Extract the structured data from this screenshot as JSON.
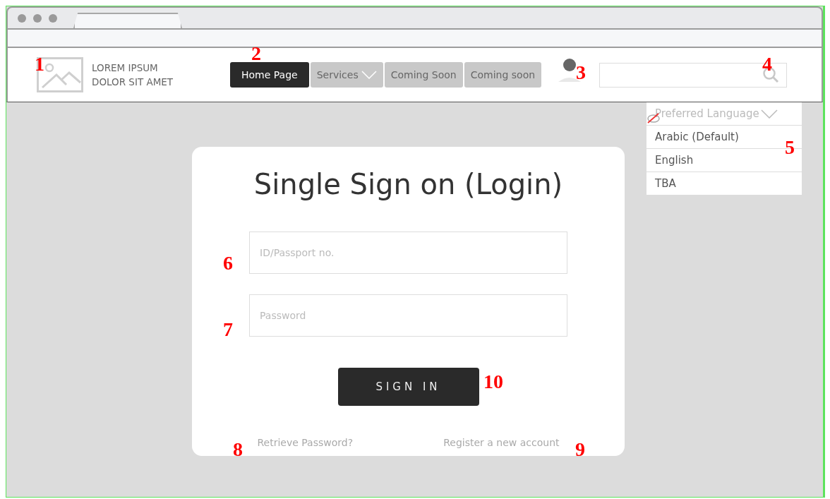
{
  "logo": {
    "line_1": "LOREM IPSUM",
    "line_2": "DOLOR SIT AMET"
  },
  "nav": [
    {
      "label": "Home Page",
      "selected": true,
      "has_menu": false
    },
    {
      "label": "Services",
      "selected": false,
      "has_menu": true
    },
    {
      "label": "Coming Soon",
      "selected": false,
      "has_menu": false
    },
    {
      "label": "Coming soon",
      "selected": false,
      "has_menu": false
    }
  ],
  "language_menu": {
    "placeholder": "Preferred Language",
    "hidden": true,
    "options": [
      {
        "label": "Arabic (Default)"
      },
      {
        "label": "English"
      },
      {
        "label": "TBA"
      }
    ]
  },
  "login": {
    "title": "Single Sign on (Login)",
    "fields": [
      {
        "placeholder": "ID/Passport no."
      },
      {
        "placeholder": "Password"
      }
    ],
    "button": "SIGN IN",
    "links": [
      "Retrieve Password?",
      "Register a new account"
    ]
  },
  "annotations": [
    {
      "label": "1"
    },
    {
      "label": "2"
    },
    {
      "label": "3"
    },
    {
      "label": "4"
    },
    {
      "label": "5"
    },
    {
      "label": "6"
    },
    {
      "label": "7"
    },
    {
      "label": "8"
    },
    {
      "label": "9"
    },
    {
      "label": "10"
    }
  ]
}
